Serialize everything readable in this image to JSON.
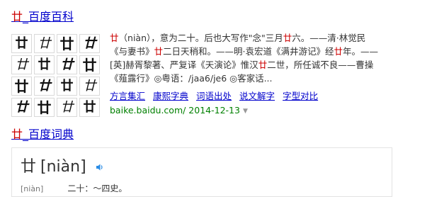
{
  "result1": {
    "title_em": "廿",
    "title_rest": "_百度百科",
    "glyph": "廿",
    "lines": [
      [
        {
          "t": "廿",
          "em": true
        },
        {
          "t": "（niàn），意为二十。后也大写作\"念\"三月"
        },
        {
          "t": "廿",
          "em": true
        },
        {
          "t": "六。——清·林觉民"
        }
      ],
      [
        {
          "t": "《与妻书》"
        },
        {
          "t": "廿",
          "em": true
        },
        {
          "t": "二日天稍和。——明·袁宏道《满井游记》经"
        },
        {
          "t": "廿",
          "em": true
        },
        {
          "t": "年。——"
        }
      ],
      [
        {
          "t": "[英]赫胥黎著、严复译《天演论》惟汉"
        },
        {
          "t": "廿",
          "em": true
        },
        {
          "t": "二世，所任诚不良——曹操"
        }
      ],
      [
        {
          "t": "《薤露行》◎粤语：/jaa6/je6 ◎客家话..."
        }
      ]
    ],
    "links": [
      "方言集汇",
      "康熙字典",
      "词语出处",
      "说文解字",
      "字型对比"
    ],
    "site": "baike.baidu.com/ 2014-12-13",
    "site_caret": "▼"
  },
  "result2": {
    "title_em": "廿",
    "title_rest": "_百度词典",
    "headword": "廿",
    "pinyin": "[niàn]",
    "sub_label": "[niàn]",
    "sub_text": "二十：～四史。"
  },
  "colors": {
    "link": "#0000cc",
    "em": "#cc0000",
    "site": "#008000",
    "speaker": "#2b8de6"
  }
}
